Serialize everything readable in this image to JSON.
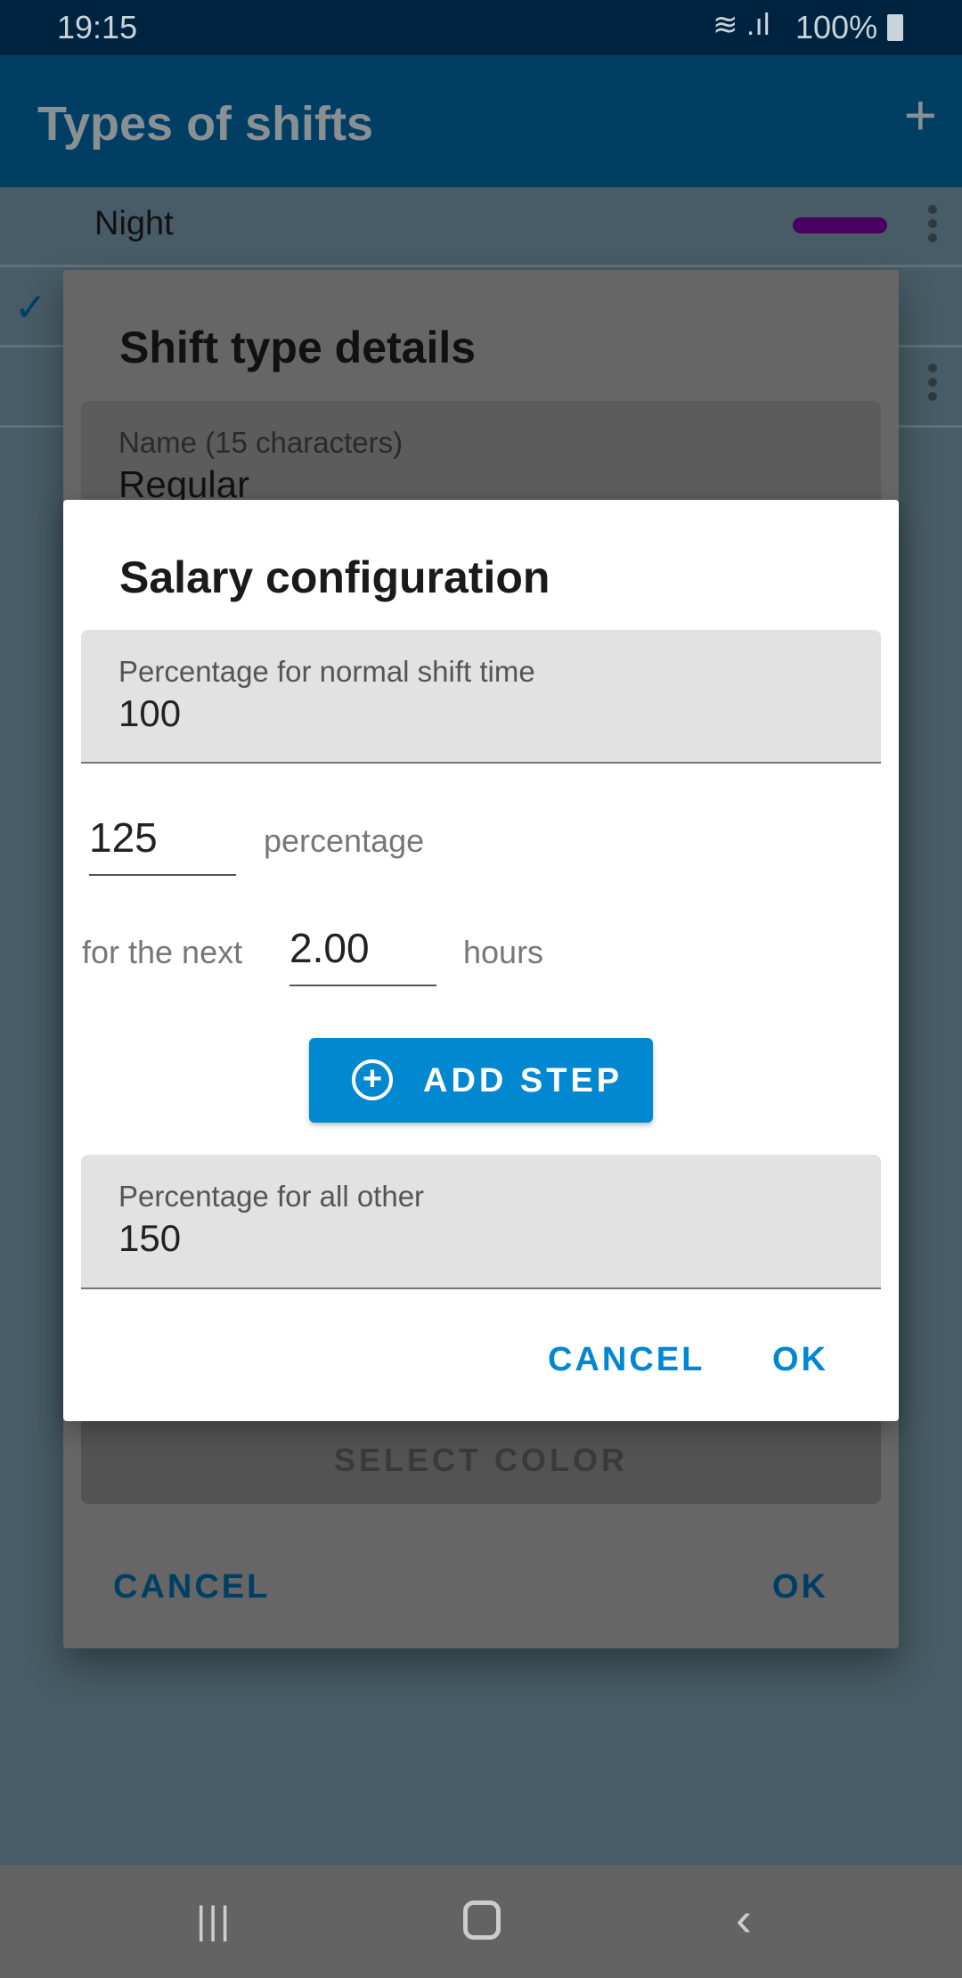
{
  "status_bar": {
    "time": "19:15",
    "battery": "100%"
  },
  "app_bar": {
    "title": "Types of shifts",
    "add_icon": "plus-icon"
  },
  "list": {
    "items": [
      {
        "label": "Night",
        "color": "#4a0060"
      }
    ]
  },
  "shift_dialog": {
    "title": "Shift type details",
    "name_label": "Name (15 characters)",
    "name_value": "Regular",
    "select_color": "SELECT COLOR",
    "cancel": "CANCEL",
    "ok": "OK"
  },
  "salary_dialog": {
    "title": "Salary configuration",
    "normal_label": "Percentage for normal shift time",
    "normal_value": "100",
    "step_percentage": "125",
    "step_percentage_unit": "percentage",
    "step_prefix": "for the next",
    "step_hours": "2.00",
    "step_hours_unit": "hours",
    "add_step": "ADD STEP",
    "other_label": "Percentage for all other",
    "other_value": "150",
    "cancel": "CANCEL",
    "ok": "OK",
    "accent": "#0288d1"
  }
}
